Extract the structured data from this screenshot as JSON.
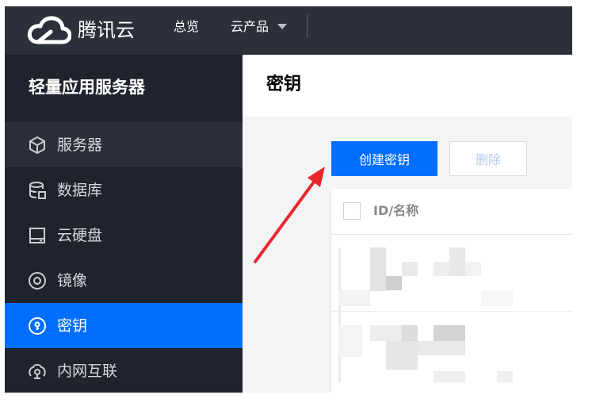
{
  "header": {
    "brand": "腾讯云",
    "nav": [
      {
        "label": "总览"
      },
      {
        "label": "云产品"
      }
    ]
  },
  "sidebar": {
    "title": "轻量应用服务器",
    "items": [
      {
        "label": "服务器",
        "icon": "cube-icon"
      },
      {
        "label": "数据库",
        "icon": "database-icon"
      },
      {
        "label": "云硬盘",
        "icon": "disk-icon"
      },
      {
        "label": "镜像",
        "icon": "image-disc-icon"
      },
      {
        "label": "密钥",
        "icon": "key-icon",
        "active": true
      },
      {
        "label": "内网互联",
        "icon": "network-icon"
      }
    ]
  },
  "main": {
    "title": "密钥",
    "create_label": "创建密钥",
    "delete_label": "删除",
    "table": {
      "columns": [
        "ID/名称"
      ]
    }
  },
  "colors": {
    "topbar": "#2b303b",
    "sidebar": "#1f232d",
    "accent": "#006eff",
    "annotation_arrow": "#e8262b"
  }
}
